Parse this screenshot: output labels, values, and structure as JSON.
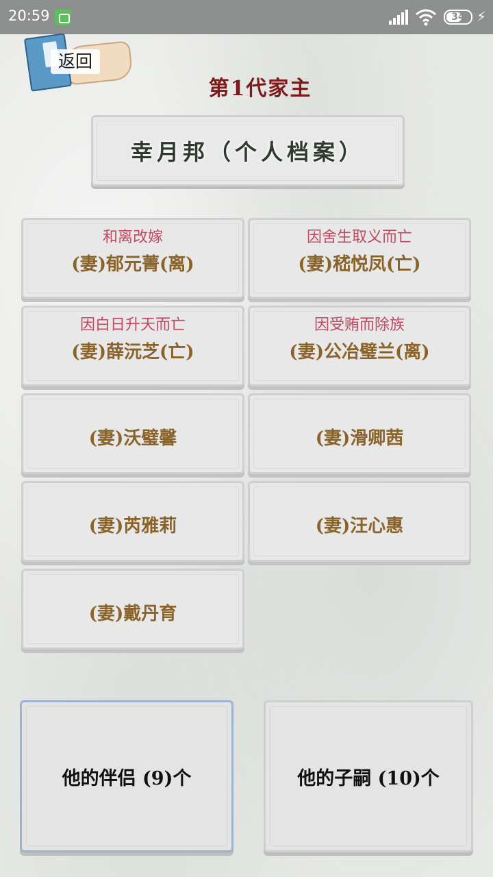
{
  "status_bar": {
    "time": "20:59",
    "battery": "34",
    "icons": [
      "app-notification-icon",
      "signal-icon",
      "wifi-icon",
      "battery-icon",
      "charging-icon"
    ]
  },
  "header": {
    "back_label": "返回",
    "title": "第1代家主"
  },
  "profile": {
    "name_plaque": "幸月邦（个人档案）"
  },
  "spouses": [
    {
      "status": "和离改嫁",
      "name": "(妻)郁元菁(离)"
    },
    {
      "status": "因舍生取义而亡",
      "name": "(妻)嵇悦凤(亡)"
    },
    {
      "status": "因白日升天而亡",
      "name": "(妻)薛沅芝(亡)"
    },
    {
      "status": "因受贿而除族",
      "name": "(妻)公冶璧兰(离)"
    },
    {
      "status": "",
      "name": "(妻)沃璧馨"
    },
    {
      "status": "",
      "name": "(妻)滑卿茜"
    },
    {
      "status": "",
      "name": "(妻)芮雅莉"
    },
    {
      "status": "",
      "name": "(妻)汪心惠"
    },
    {
      "status": "",
      "name": "(妻)戴丹育"
    }
  ],
  "bottom_tabs": {
    "partners_label": "他的伴侣 (9)个",
    "children_label": "他的子嗣 (10)个",
    "selected": "partners"
  },
  "colors": {
    "title": "#7e1919",
    "status_text": "#c0485f",
    "spouse_name": "#8a6328",
    "card_bg": "#e8e8e8",
    "status_bar_bg": "#8d8f8e"
  }
}
